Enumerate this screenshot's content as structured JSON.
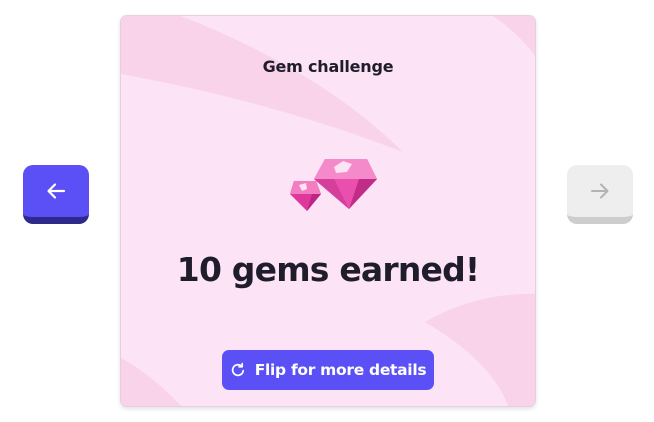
{
  "card": {
    "title": "Gem challenge",
    "headline": "10 gems earned!",
    "flip_label": "Flip for more details",
    "gem_icon": "gems-icon"
  },
  "navigation": {
    "prev_icon": "arrow-left-icon",
    "next_icon": "arrow-right-icon",
    "prev_state": "enabled",
    "next_state": "disabled"
  },
  "colors": {
    "accent": "#5b50f5",
    "accent_dark": "#2e2a8c",
    "card_background": "#fce3f5",
    "gem_pink": "#e94bae",
    "text": "#1f1d2b"
  }
}
